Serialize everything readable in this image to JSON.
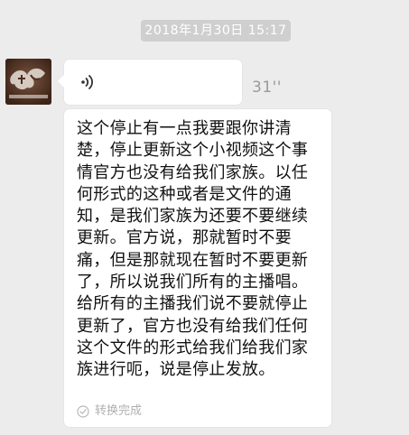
{
  "chat": {
    "timestamp": "2018年1月30日 15:17",
    "voice_message": {
      "duration": "31''",
      "icon": "voice-wave-icon"
    },
    "transcript": {
      "text": "这个停止有一点我要跟你讲清楚，停止更新这个小视频这个事情官方也没有给我们家族。以任何形式的这种或者是文件的通知，是我们家族为还要不要继续更新。官方说，那就暂时不要痛，但是那就现在暂时不要更新了，所以说我们所有的主播唱。给所有的主播我们说不要就停止更新了，官方也没有给我们任何这个文件的形式给我们给我们家族进行呃，说是停止发放。",
      "status": "转换完成",
      "status_icon": "check-circle-icon"
    }
  },
  "colors": {
    "background": "#ececec",
    "bubble": "#ffffff",
    "timestamp_bg": "#cfcfcf",
    "muted_text": "#9a9a9a"
  }
}
